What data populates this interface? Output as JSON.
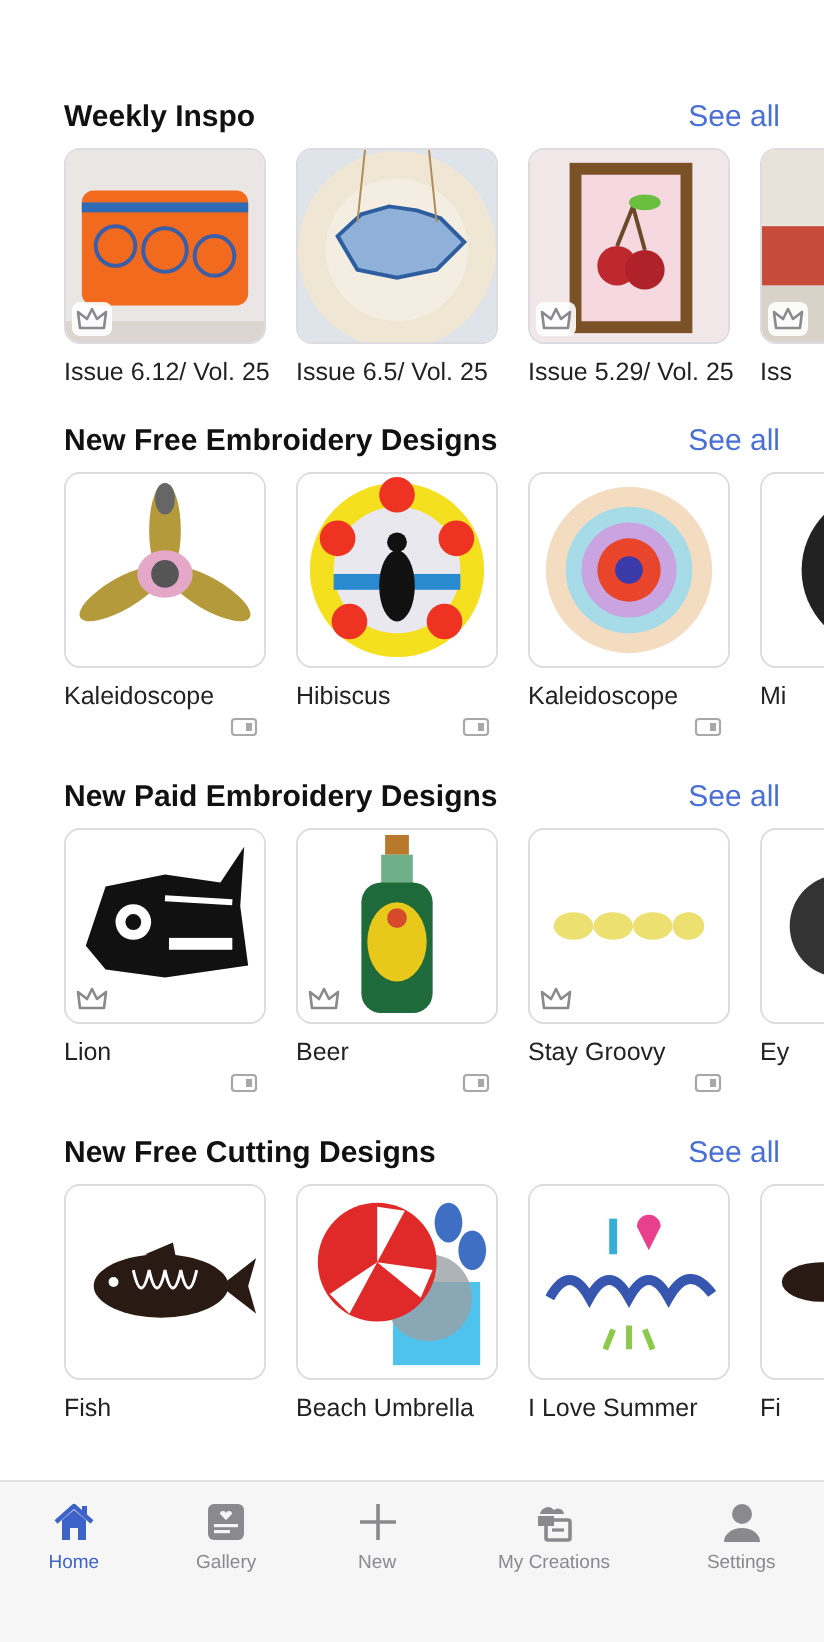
{
  "sections": [
    {
      "title": "Weekly Inspo",
      "see_all": "See all",
      "items": [
        {
          "label": "Issue 6.12/ Vol. 25",
          "crowned": true,
          "format_badge": false
        },
        {
          "label": "Issue 6.5/ Vol. 25",
          "crowned": false,
          "format_badge": false
        },
        {
          "label": "Issue 5.29/ Vol. 25",
          "crowned": true,
          "format_badge": false
        },
        {
          "label": "Iss",
          "crowned": true,
          "format_badge": false
        }
      ]
    },
    {
      "title": "New Free Embroidery Designs",
      "see_all": "See all",
      "items": [
        {
          "label": "Kaleidoscope",
          "crowned": false,
          "format_badge": true
        },
        {
          "label": "Hibiscus",
          "crowned": false,
          "format_badge": true
        },
        {
          "label": "Kaleidoscope",
          "crowned": false,
          "format_badge": true
        },
        {
          "label": "Mi",
          "crowned": false,
          "format_badge": false
        }
      ]
    },
    {
      "title": "New Paid Embroidery Designs",
      "see_all": "See all",
      "items": [
        {
          "label": "Lion",
          "crowned": true,
          "format_badge": true
        },
        {
          "label": "Beer",
          "crowned": true,
          "format_badge": true
        },
        {
          "label": "Stay Groovy",
          "crowned": true,
          "format_badge": true
        },
        {
          "label": "Ey",
          "crowned": false,
          "format_badge": false
        }
      ]
    },
    {
      "title": "New Free Cutting Designs",
      "see_all": "See all",
      "items": [
        {
          "label": "Fish",
          "crowned": false,
          "format_badge": false
        },
        {
          "label": "Beach Umbrella",
          "crowned": false,
          "format_badge": false
        },
        {
          "label": "I Love Summer",
          "crowned": false,
          "format_badge": false
        },
        {
          "label": "Fi",
          "crowned": false,
          "format_badge": false
        }
      ]
    }
  ],
  "tab_bar": [
    {
      "label": "Home",
      "selected": true
    },
    {
      "label": "Gallery",
      "selected": false
    },
    {
      "label": "New",
      "selected": false
    },
    {
      "label": "My Creations",
      "selected": false
    },
    {
      "label": "Settings",
      "selected": false
    }
  ]
}
